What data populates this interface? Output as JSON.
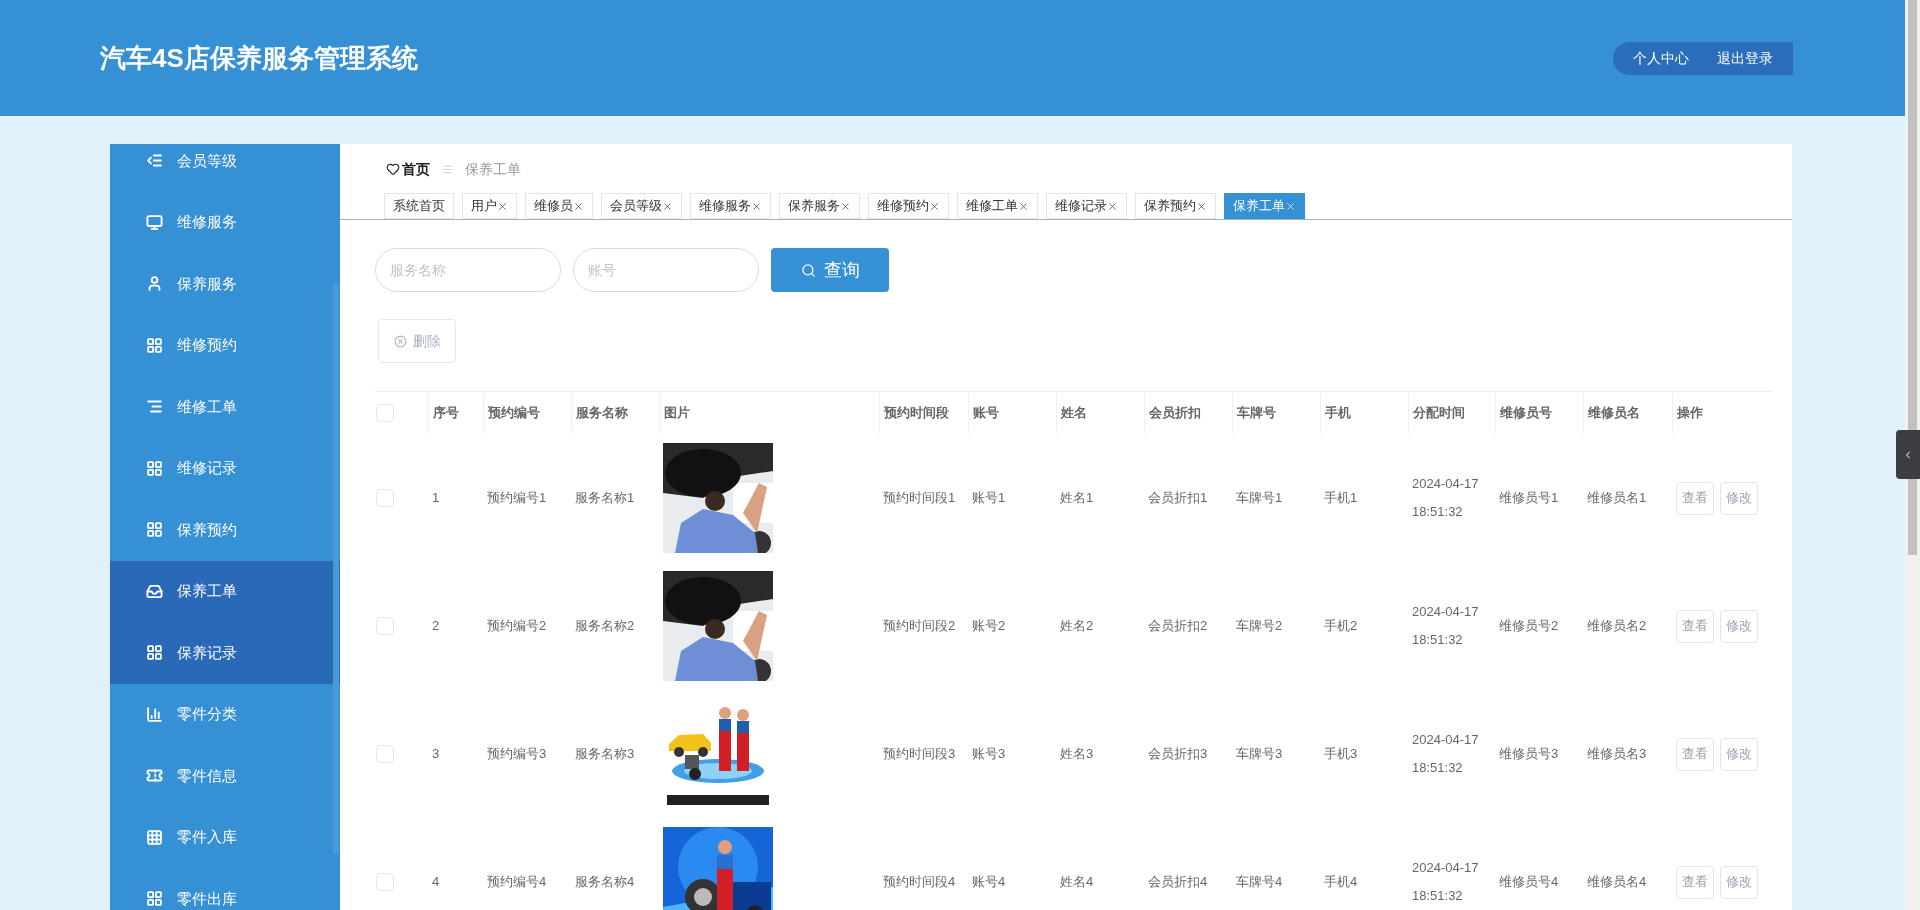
{
  "header": {
    "title": "汽车4S店保养服务管理系统",
    "actions": [
      "个人中心",
      "退出登录"
    ]
  },
  "sidebar": {
    "items": [
      {
        "label": "会员等级",
        "highlighted": false
      },
      {
        "label": "维修服务",
        "highlighted": false
      },
      {
        "label": "保养服务",
        "highlighted": false
      },
      {
        "label": "维修预约",
        "highlighted": false
      },
      {
        "label": "维修工单",
        "highlighted": false
      },
      {
        "label": "维修记录",
        "highlighted": false
      },
      {
        "label": "保养预约",
        "highlighted": false
      },
      {
        "label": "保养工单",
        "highlighted": true
      },
      {
        "label": "保养记录",
        "highlighted": true
      },
      {
        "label": "零件分类",
        "highlighted": false
      },
      {
        "label": "零件信息",
        "highlighted": false
      },
      {
        "label": "零件入库",
        "highlighted": false
      },
      {
        "label": "零件出库",
        "highlighted": false
      }
    ]
  },
  "breadcrumb": [
    "首页",
    "保养工单"
  ],
  "tabs": [
    {
      "label": "系统首页",
      "closable": false,
      "selected": false
    },
    {
      "label": "用户",
      "closable": true,
      "selected": false
    },
    {
      "label": "维修员",
      "closable": true,
      "selected": false
    },
    {
      "label": "会员等级",
      "closable": true,
      "selected": false
    },
    {
      "label": "维修服务",
      "closable": true,
      "selected": false
    },
    {
      "label": "保养服务",
      "closable": true,
      "selected": false
    },
    {
      "label": "维修预约",
      "closable": true,
      "selected": false
    },
    {
      "label": "维修工单",
      "closable": true,
      "selected": false
    },
    {
      "label": "维修记录",
      "closable": true,
      "selected": false
    },
    {
      "label": "保养预约",
      "closable": true,
      "selected": false
    },
    {
      "label": "保养工单",
      "closable": true,
      "selected": true
    }
  ],
  "search": {
    "fields": [
      {
        "placeholder": "服务名称"
      },
      {
        "placeholder": "账号"
      }
    ],
    "button": "查询"
  },
  "delete_button": "删除",
  "table": {
    "select_all_checked": false,
    "columns": [
      "序号",
      "预约编号",
      "服务名称",
      "图片",
      "预约时间段",
      "账号",
      "姓名",
      "会员折扣",
      "车牌号",
      "手机",
      "分配时间",
      "维修员号",
      "维修员名",
      "操作"
    ],
    "rows": [
      {
        "checked": false,
        "index": "1",
        "appointment_no": "预约编号1",
        "service_name": "服务名称1",
        "time_slot": "预约时间段1",
        "account": "账号1",
        "name": "姓名1",
        "discount": "会员折扣1",
        "plate": "车牌号1",
        "phone": "手机1",
        "assigned_time": "2024-04-17 18:51:32",
        "worker_no": "维修员号1",
        "worker_name": "维修员名1",
        "actions": [
          "查看",
          "修改"
        ]
      },
      {
        "checked": false,
        "index": "2",
        "appointment_no": "预约编号2",
        "service_name": "服务名称2",
        "time_slot": "预约时间段2",
        "account": "账号2",
        "name": "姓名2",
        "discount": "会员折扣2",
        "plate": "车牌号2",
        "phone": "手机2",
        "assigned_time": "2024-04-17 18:51:32",
        "worker_no": "维修员号2",
        "worker_name": "维修员名2",
        "actions": [
          "查看",
          "修改"
        ]
      },
      {
        "checked": false,
        "index": "3",
        "appointment_no": "预约编号3",
        "service_name": "服务名称3",
        "time_slot": "预约时间段3",
        "account": "账号3",
        "name": "姓名3",
        "discount": "会员折扣3",
        "plate": "车牌号3",
        "phone": "手机3",
        "assigned_time": "2024-04-17 18:51:32",
        "worker_no": "维修员号3",
        "worker_name": "维修员名3",
        "actions": [
          "查看",
          "修改"
        ]
      },
      {
        "checked": false,
        "index": "4",
        "appointment_no": "预约编号4",
        "service_name": "服务名称4",
        "time_slot": "预约时间段4",
        "account": "账号4",
        "name": "姓名4",
        "discount": "会员折扣4",
        "plate": "车牌号4",
        "phone": "手机4",
        "assigned_time": "2024-04-17 18:51:32",
        "worker_no": "维修员号4",
        "worker_name": "维修员名4",
        "actions": [
          "查看",
          "修改"
        ]
      }
    ]
  }
}
